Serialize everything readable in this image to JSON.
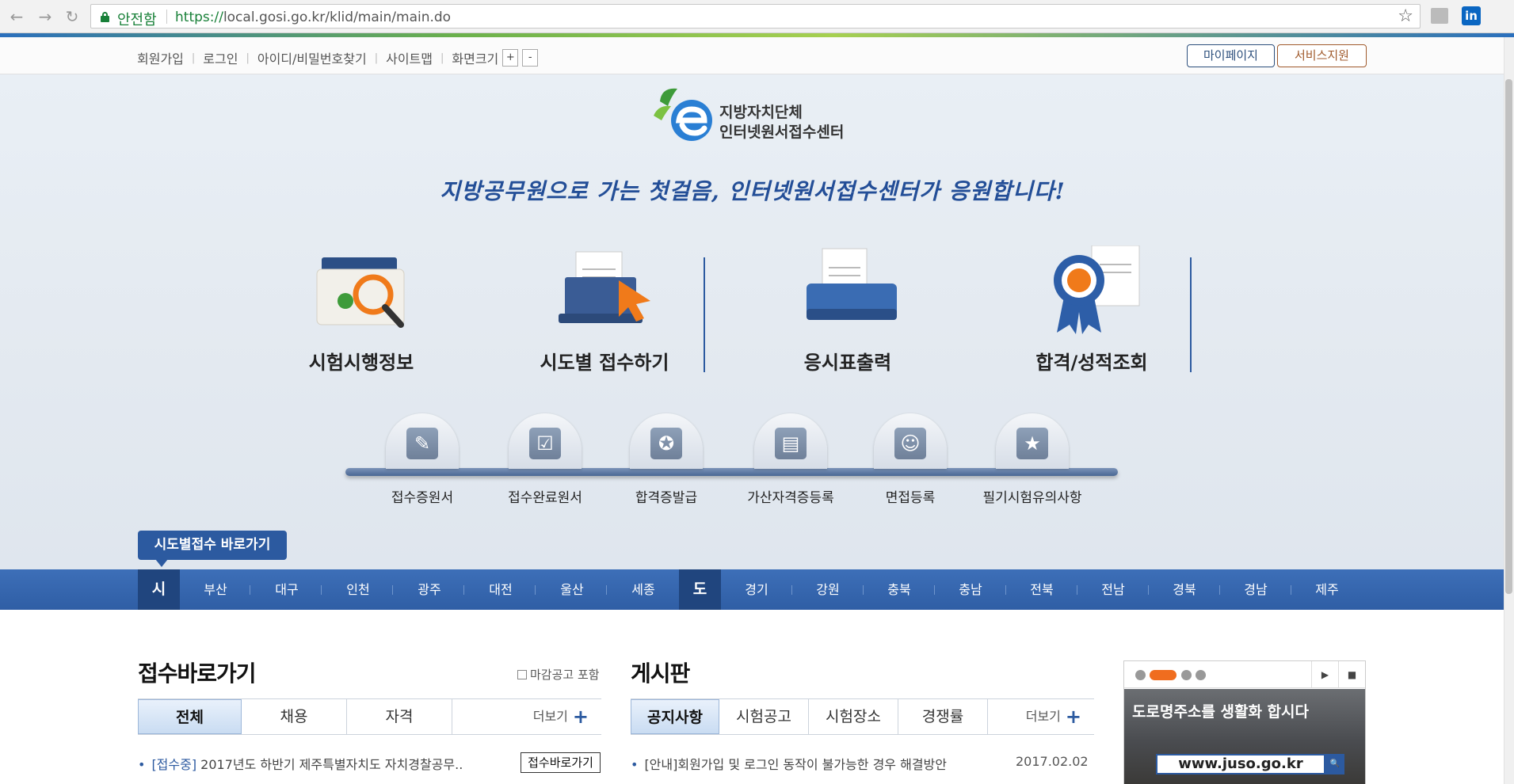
{
  "browser": {
    "secure_label": "안전함",
    "url_scheme": "https://",
    "url_host": "local.gosi.go.kr",
    "url_path": "/klid/main/main.do",
    "ext_label": "in"
  },
  "util": {
    "links": [
      "회원가입",
      "로그인",
      "아이디/비밀번호찾기",
      "사이트맵",
      "화면크기"
    ],
    "zoom_in": "+",
    "zoom_out": "-",
    "mypage": "마이페이지",
    "service": "서비스지원"
  },
  "logo": {
    "line1": "지방자치단체",
    "line2": "인터넷원서접수센터"
  },
  "slogan": "지방공무원으로 가는 첫걸음, 인터넷원서접수센터가 응원합니다!",
  "main_menu": [
    {
      "label": "시험시행정보",
      "icon": "folder-search-icon"
    },
    {
      "label": "시도별 접수하기",
      "icon": "laptop-click-icon"
    },
    {
      "label": "응시표출력",
      "icon": "printer-icon"
    },
    {
      "label": "합격/성적조회",
      "icon": "award-ribbon-icon"
    }
  ],
  "sub_menu": [
    {
      "label": "접수증원서",
      "icon": "pencil-icon",
      "glyph": "✎"
    },
    {
      "label": "접수완료원서",
      "icon": "checkbox-icon",
      "glyph": "☑"
    },
    {
      "label": "합격증발급",
      "icon": "medal-icon",
      "glyph": "✪"
    },
    {
      "label": "가산자격증등록",
      "icon": "id-card-icon",
      "glyph": "▤"
    },
    {
      "label": "면접등록",
      "icon": "person-icon",
      "glyph": "☺"
    },
    {
      "label": "필기시험유의사항",
      "icon": "star-document-icon",
      "glyph": "★"
    }
  ],
  "shortcut_tag": "시도별접수 바로가기",
  "regions": {
    "city_label": "시",
    "cities": [
      "부산",
      "대구",
      "인천",
      "광주",
      "대전",
      "울산",
      "세종"
    ],
    "province_label": "도",
    "provinces": [
      "경기",
      "강원",
      "충북",
      "충남",
      "전북",
      "전남",
      "경북",
      "경남",
      "제주"
    ]
  },
  "apply": {
    "title": "접수바로가기",
    "checkbox_label": "마감공고 포함",
    "tabs": [
      "전체",
      "채용",
      "자격"
    ],
    "more": "더보기",
    "row_badge": "[접수중]",
    "row_text": " 2017년도 하반기 제주특별자치도 자치경찰공무..",
    "row_button": "접수바로가기"
  },
  "board": {
    "title": "게시판",
    "tabs": [
      "공지사항",
      "시험공고",
      "시험장소",
      "경쟁률"
    ],
    "more": "더보기",
    "row_text": "[안내]회원가입 및 로그인 동작이 불가능한 경우 해결방안",
    "row_date": "2017.02.02"
  },
  "banner": {
    "title": "도로명주소를 생활화 합시다",
    "search_text": "www.juso.go.kr",
    "play": "▶",
    "stop": "■",
    "go": "🔍"
  },
  "colors": {
    "primary": "#2c5aa0",
    "accent": "#f06d1f",
    "secure": "#188038"
  }
}
